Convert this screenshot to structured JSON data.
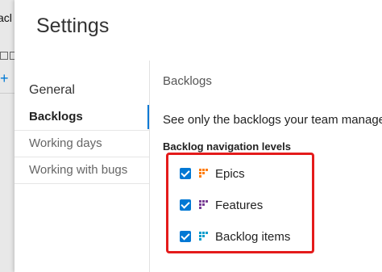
{
  "background": {
    "title_fragment": "acl"
  },
  "panel": {
    "title": "Settings",
    "nav": [
      {
        "label": "General"
      },
      {
        "label": "Backlogs"
      },
      {
        "label": "Working days"
      },
      {
        "label": "Working with bugs"
      }
    ]
  },
  "content": {
    "section_title": "Backlogs",
    "description": "See only the backlogs your team manages",
    "levels_label": "Backlog navigation levels",
    "levels": [
      {
        "label": "Epics",
        "checked": true,
        "icon": "epic-icon",
        "color": "#ff7b00"
      },
      {
        "label": "Features",
        "checked": true,
        "icon": "feature-icon",
        "color": "#773b93"
      },
      {
        "label": "Backlog items",
        "checked": true,
        "icon": "backlog-item-icon",
        "color": "#009ccc"
      }
    ]
  },
  "colors": {
    "accent": "#0078d4",
    "highlight": "#e41b1b"
  }
}
